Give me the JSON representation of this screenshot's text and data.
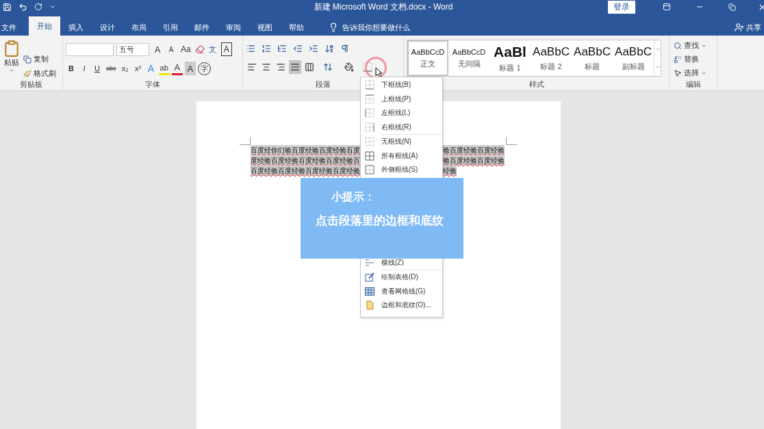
{
  "title_bar": {
    "title": "新建 Microsoft Word 文档.docx  -  Word",
    "login": "登录"
  },
  "menu_tabs": [
    {
      "label": "文件",
      "selected": false
    },
    {
      "label": "开始",
      "selected": true
    },
    {
      "label": "插入",
      "selected": false
    },
    {
      "label": "设计",
      "selected": false
    },
    {
      "label": "布局",
      "selected": false
    },
    {
      "label": "引用",
      "selected": false
    },
    {
      "label": "邮件",
      "selected": false
    },
    {
      "label": "审阅",
      "selected": false
    },
    {
      "label": "视图",
      "selected": false
    },
    {
      "label": "帮助",
      "selected": false
    }
  ],
  "tell_me": "告诉我你想要做什么",
  "share": "共享",
  "clipboard": {
    "paste": "粘贴",
    "copy": "复制",
    "format_painter": "格式刷",
    "label": "剪贴板"
  },
  "font": {
    "size": "五号",
    "label": "字体",
    "row1": [
      {
        "kind": "grow",
        "text": "A"
      },
      {
        "kind": "shrink",
        "text": "A"
      },
      {
        "kind": "case",
        "text": "Aa"
      },
      {
        "kind": "clear"
      },
      {
        "kind": "phonetic",
        "text": "文"
      },
      {
        "kind": "boxed",
        "text": "A"
      }
    ],
    "row2": [
      {
        "kind": "bold",
        "text": "B"
      },
      {
        "kind": "italic",
        "text": "I"
      },
      {
        "kind": "underline",
        "text": "U"
      },
      {
        "kind": "strike",
        "text": "abc"
      },
      {
        "kind": "sub",
        "text": "x₂"
      },
      {
        "kind": "sup",
        "text": "x²"
      },
      {
        "kind": "effect",
        "text": "A"
      },
      {
        "kind": "highlight",
        "text": "ab"
      },
      {
        "kind": "color",
        "text": "A"
      },
      {
        "kind": "shade",
        "text": "A"
      },
      {
        "kind": "enclose",
        "text": "字"
      }
    ]
  },
  "paragraph": {
    "label": "段落",
    "alignments": [
      {
        "selected": false
      },
      {
        "selected": false
      },
      {
        "selected": false
      },
      {
        "selected": true
      },
      {
        "selected": false
      }
    ]
  },
  "styles": {
    "label": "样式",
    "items": [
      {
        "preview": "AaBbCcD",
        "name": "正文",
        "selected": true,
        "kind": "normal"
      },
      {
        "preview": "AaBbCcD",
        "name": "无间隔",
        "selected": false,
        "kind": "normal"
      },
      {
        "preview": "AaBl",
        "name": "标题 1",
        "selected": false,
        "kind": "heading"
      },
      {
        "preview": "AaBbC",
        "name": "标题 2",
        "selected": false,
        "kind": "large"
      },
      {
        "preview": "AaBbC",
        "name": "标题",
        "selected": false,
        "kind": "large"
      },
      {
        "preview": "AaBbC",
        "name": "副标题",
        "selected": false,
        "kind": "large"
      }
    ]
  },
  "editing": {
    "find": "查找",
    "replace": "替换",
    "select": "选择",
    "label": "编辑"
  },
  "document": {
    "lines": [
      {
        "left": "百度经你们验百度经验百度经验百度",
        "right": "验百度经验百度经验"
      },
      {
        "left": "度经验百度经验百度经验百度经验百",
        "right": "验百度经验百度经验"
      },
      {
        "left": "百度经验百度经验百度经验百度经验",
        "right": "经验"
      }
    ]
  },
  "border_menu": {
    "top_items": [
      {
        "label": "下框线(B)",
        "kind": "bottom"
      },
      {
        "label": "上框线(P)",
        "kind": "top"
      },
      {
        "label": "左框线(L)",
        "kind": "left"
      },
      {
        "label": "右框线(R)",
        "kind": "right"
      },
      {
        "label": "无框线(N)",
        "kind": "none"
      },
      {
        "label": "所有框线(A)",
        "kind": "all"
      },
      {
        "label": "外侧框线(S)",
        "kind": "outside"
      }
    ],
    "bottom_items": [
      {
        "label": "横线(Z)",
        "kind": "horizontal"
      },
      {
        "label": "绘制表格(D)",
        "kind": "draw"
      },
      {
        "label": "查看网格线(G)",
        "kind": "grid"
      },
      {
        "label": "边框和底纹(O)...",
        "kind": "dialog"
      }
    ]
  },
  "tip": {
    "title": "小提示：",
    "body": "点击段落里的边框和底纹"
  }
}
